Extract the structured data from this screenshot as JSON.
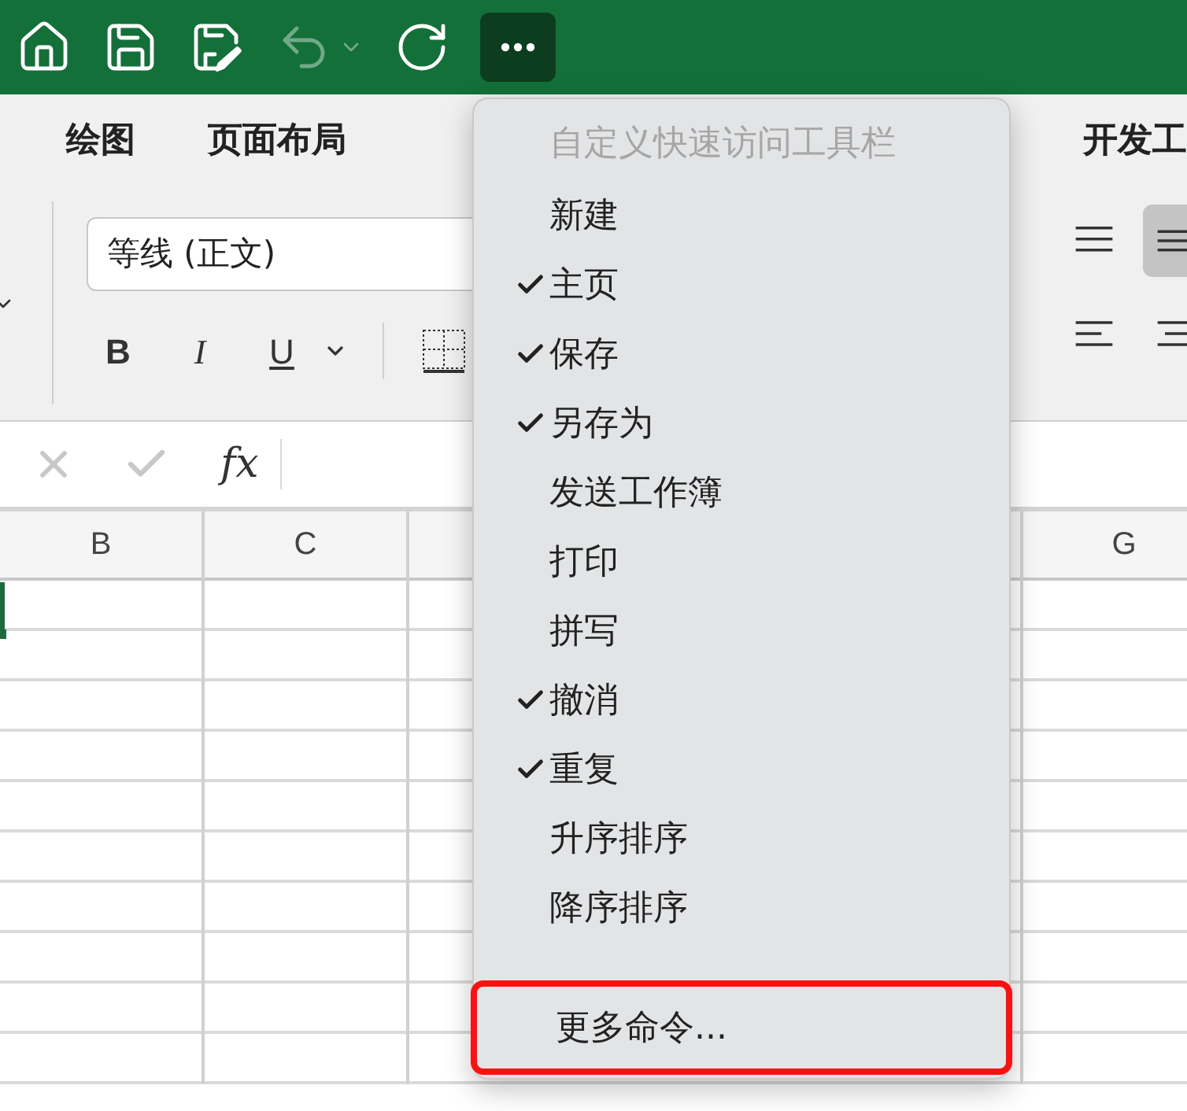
{
  "quick_access": [
    {
      "kind": "home",
      "disabled": false
    },
    {
      "kind": "save",
      "disabled": false
    },
    {
      "kind": "save-as",
      "disabled": false
    },
    {
      "kind": "undo",
      "disabled": true
    },
    {
      "kind": "redo",
      "disabled": false
    }
  ],
  "more_button": {
    "pressed": true
  },
  "ribbon_tabs": [
    {
      "label": "绘图"
    },
    {
      "label": "页面布局"
    },
    {
      "label": "开发工"
    }
  ],
  "font_field": {
    "value": "等线 (正文)"
  },
  "format_buttons": [
    {
      "label": "B",
      "kind": "bold"
    },
    {
      "label": "I",
      "kind": "italic"
    },
    {
      "label": "U",
      "kind": "underline"
    }
  ],
  "align_buttons": [
    {
      "kind": "top",
      "selected": false
    },
    {
      "kind": "middle",
      "selected": true
    },
    {
      "kind": "left",
      "selected": false
    },
    {
      "kind": "center",
      "selected": false
    }
  ],
  "formula_bar": {
    "function_label": "fx"
  },
  "columns": [
    {
      "label": "B"
    },
    {
      "label": "C"
    },
    {
      "label": "G"
    }
  ],
  "menu": {
    "title": "自定义快速访问工具栏",
    "items": [
      {
        "label": "新建",
        "checked": false,
        "highlighted": false
      },
      {
        "label": "主页",
        "checked": true,
        "highlighted": false
      },
      {
        "label": "保存",
        "checked": true,
        "highlighted": false
      },
      {
        "label": "另存为",
        "checked": true,
        "highlighted": false
      },
      {
        "label": "发送工作簿",
        "checked": false,
        "highlighted": false
      },
      {
        "label": "打印",
        "checked": false,
        "highlighted": false
      },
      {
        "label": "拼写",
        "checked": false,
        "highlighted": false
      },
      {
        "label": "撤消",
        "checked": true,
        "highlighted": false
      },
      {
        "label": "重复",
        "checked": true,
        "highlighted": false
      },
      {
        "label": "升序排序",
        "checked": false,
        "highlighted": false
      },
      {
        "label": "降序排序",
        "checked": false,
        "highlighted": false
      },
      {
        "label": "更多命令...",
        "checked": false,
        "highlighted": true
      }
    ]
  }
}
